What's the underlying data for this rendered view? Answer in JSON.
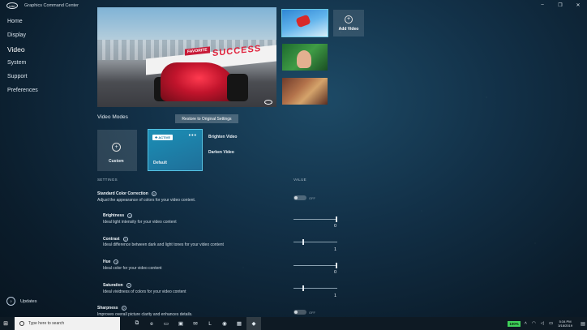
{
  "app": {
    "logo": "intel",
    "title": "Graphics Command Center"
  },
  "window_controls": {
    "minimize": "–",
    "maximize": "❐",
    "close": "✕"
  },
  "sidebar": {
    "items": [
      {
        "label": "Home"
      },
      {
        "label": "Display"
      },
      {
        "label": "Video",
        "active": true
      },
      {
        "label": "System"
      },
      {
        "label": "Support"
      },
      {
        "label": "Preferences"
      }
    ],
    "updates_label": "Updates"
  },
  "hero": {
    "banner_text": "SUCCESS",
    "tag_text": "FAVORITE"
  },
  "add_video": {
    "plus": "+",
    "label": "Add Video"
  },
  "video_modes": {
    "title": "Video Modes",
    "restore_label": "Restore to Original Settings",
    "custom": {
      "plus": "+",
      "label": "Custom"
    },
    "default": {
      "badge": "✚ ACTIVE",
      "dots": "•••",
      "label": "Default"
    },
    "brighten_label": "Brighten Video",
    "darken_label": "Darken Video"
  },
  "settings": {
    "header_settings": "SETTINGS",
    "header_value": "VALUE",
    "help_glyph": "?",
    "off_label": "OFF",
    "standard": {
      "title": "Standard Color Correction",
      "desc": "Adjust the appearance of colors for your video content.",
      "enabled": false
    },
    "brightness": {
      "title": "Brightness",
      "desc": "Ideal light intensity for your video content",
      "value": "0",
      "position": 1.0
    },
    "contrast": {
      "title": "Contrast",
      "desc": "Ideal difference between dark and light tones for your video content",
      "value": "1",
      "position": 0.22
    },
    "hue": {
      "title": "Hue",
      "desc": "Ideal color for your video content",
      "value": "0",
      "position": 1.0
    },
    "saturation": {
      "title": "Saturation",
      "desc": "Ideal vividness of colors for your video content",
      "value": "1",
      "position": 0.22
    },
    "sharpness": {
      "title": "Sharpness",
      "desc": "Improves overall picture clarity and enhances details.",
      "enabled": false
    }
  },
  "taskbar": {
    "search_placeholder": "Type here to search",
    "battery": "100%",
    "time": "5:34 PM",
    "date": "3/18/2019"
  }
}
